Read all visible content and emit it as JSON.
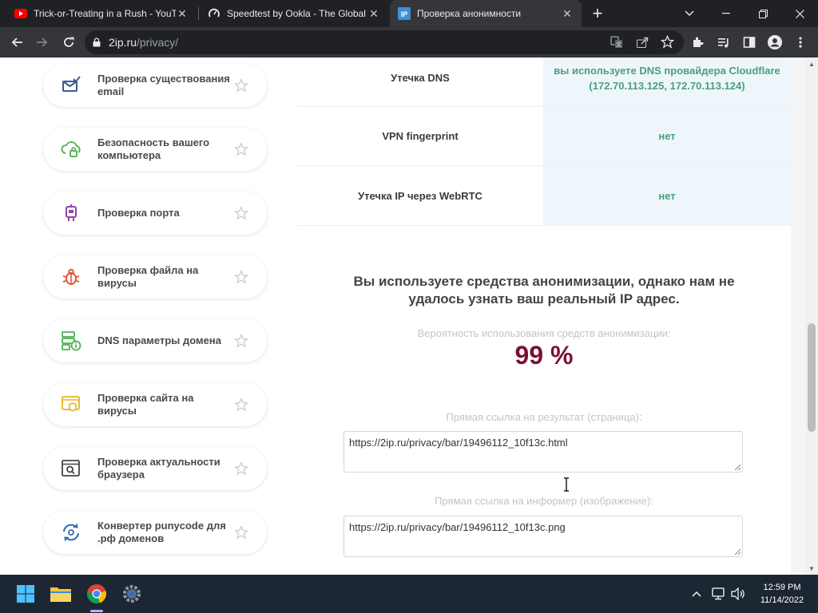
{
  "browser": {
    "tabs": [
      {
        "title": "Trick-or-Treating in a Rush - YouT",
        "favicon": "youtube-icon",
        "active": false
      },
      {
        "title": "Speedtest by Ookla - The Global",
        "favicon": "speedtest-icon",
        "active": false
      },
      {
        "title": "Проверка анонимности",
        "favicon": "2ip-icon",
        "active": true
      }
    ],
    "url_host": "2ip.ru",
    "url_path": "/privacy/"
  },
  "sidebar": {
    "items": [
      {
        "label": "Проверка существования email",
        "icon": "email-check-icon",
        "icon_color": "#3b5998"
      },
      {
        "label": "Безопасность вашего компьютера",
        "icon": "cloud-lock-icon",
        "icon_color": "#4caf50"
      },
      {
        "label": "Проверка порта",
        "icon": "port-plug-icon",
        "icon_color": "#8e44ad"
      },
      {
        "label": "Проверка файла на вирусы",
        "icon": "bug-icon",
        "icon_color": "#e2583e"
      },
      {
        "label": "DNS параметры домена",
        "icon": "dns-server-icon",
        "icon_color": "#4caf50"
      },
      {
        "label": "Проверка сайта на вирусы",
        "icon": "site-shield-icon",
        "icon_color": "#e4b520"
      },
      {
        "label": "Проверка актуальности браузера",
        "icon": "browser-search-icon",
        "icon_color": "#444444"
      },
      {
        "label": "Конвертер punycode для .рф доменов",
        "icon": "convert-arrows-icon",
        "icon_color": "#2a6db5"
      }
    ]
  },
  "results": {
    "rows": [
      {
        "label": "Утечка DNS",
        "value": "вы используете DNS провайдера Cloudflare (172.70.113.125, 172.70.113.124)"
      },
      {
        "label": "VPN fingerprint",
        "value": "нет"
      },
      {
        "label": "Утечка IP через WebRTC",
        "value": "нет"
      }
    ],
    "headline": "Вы используете средства анонимизации, однако нам не удалось узнать ваш реальный IP адрес.",
    "probability_label": "Вероятность использования средств анонимизации:",
    "probability_value": "99 %",
    "page_link_label": "Прямая ссылка на результат (страница):",
    "page_link_value": "https://2ip.ru/privacy/bar/19496112_10f13c.html",
    "image_link_label": "Прямая ссылка на информер (изображение):",
    "image_link_value": "https://2ip.ru/privacy/bar/19496112_10f13c.png"
  },
  "taskbar": {
    "time": "12:59 PM",
    "date": "11/14/2022"
  },
  "colors": {
    "accent_green": "#4b9e7d",
    "percent_maroon": "#7b1032",
    "value_cell_bg": "#eef6fb"
  }
}
